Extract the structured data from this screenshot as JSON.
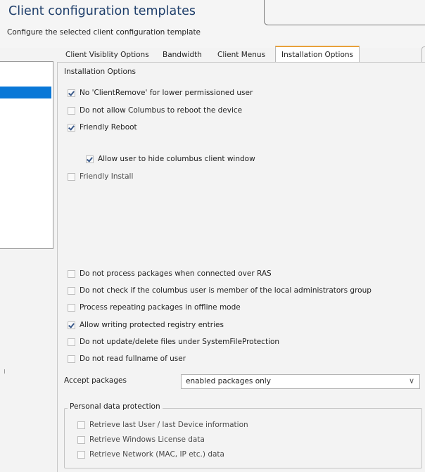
{
  "header": {
    "title": "Client configuration templates",
    "subtitle": "Configure the selected client configuration template"
  },
  "tabs": [
    {
      "label": "Client Visiblity Options",
      "active": false
    },
    {
      "label": "Bandwidth",
      "active": false
    },
    {
      "label": "Client Menus",
      "active": false
    },
    {
      "label": "Installation Options",
      "active": true
    }
  ],
  "section": {
    "title": "Installation Options"
  },
  "options": [
    {
      "label": "No 'ClientRemove' for lower permissioned user",
      "checked": true
    },
    {
      "label": "Do not allow Columbus to reboot the device",
      "checked": false
    },
    {
      "label": "Friendly Reboot",
      "checked": true
    },
    {
      "label": "Allow user to hide columbus client window",
      "checked": true
    },
    {
      "label": "Friendly Install",
      "checked": false
    },
    {
      "label": "Do not process packages when connected over RAS",
      "checked": false
    },
    {
      "label": "Do not check if the columbus user is member of the local administrators group",
      "checked": false
    },
    {
      "label": "Process repeating packages in offline mode",
      "checked": false
    },
    {
      "label": "Allow writing protected registry entries",
      "checked": true
    },
    {
      "label": "Do not update/delete files under SystemFileProtection",
      "checked": false
    },
    {
      "label": "Do not read fullname of user",
      "checked": false
    }
  ],
  "accept_packages": {
    "label": "Accept packages",
    "selected": "enabled packages only"
  },
  "personal_data": {
    "legend": "Personal data protection",
    "options": [
      {
        "label": "Retrieve last User / last Device information",
        "checked": false
      },
      {
        "label": "Retrieve Windows License data",
        "checked": false
      },
      {
        "label": "Retrieve Network (MAC, IP etc.) data",
        "checked": false
      }
    ]
  },
  "colors": {
    "title": "#1f3f6b",
    "selection": "#0a78d7",
    "active_tab_accent": "#e8a13a"
  },
  "icons": {
    "check": "checkmark-icon",
    "dropdown": "chevron-down-icon"
  }
}
